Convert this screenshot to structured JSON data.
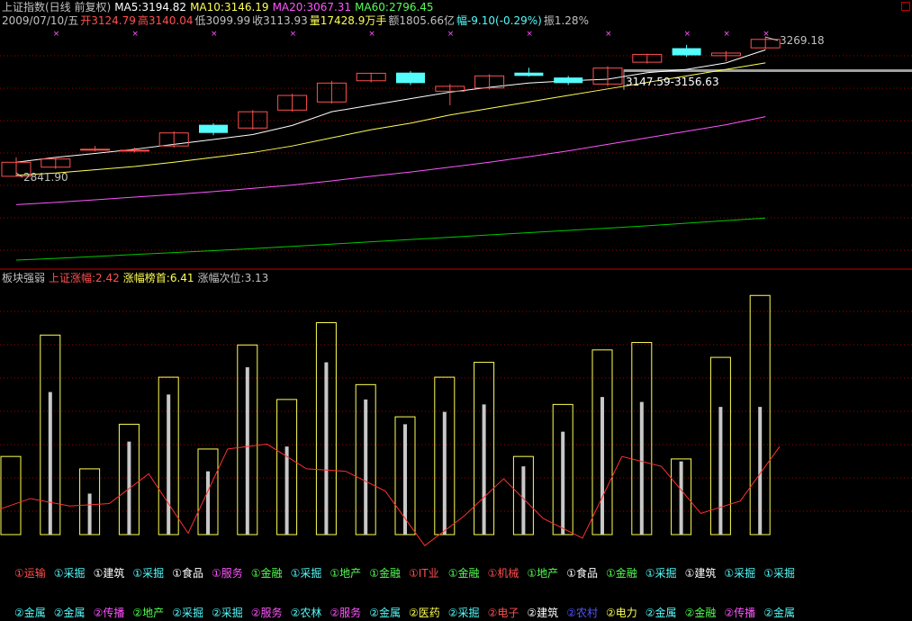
{
  "header": {
    "title": "上证指数(日线 前复权)",
    "ma5": "MA5:3194.82",
    "ma10": "MA10:3146.19",
    "ma20": "MA20:3067.31",
    "ma60": "MA60:2796.45",
    "date": "2009/07/10/五",
    "open": "开3124.79",
    "high": "高3140.04",
    "low": "低3099.99",
    "close": "收3113.93",
    "volume": "量17428.9万手",
    "amount": "额1805.66亿",
    "change": "幅-9.10(-0.29%)",
    "amplitude": "振1.28%"
  },
  "annotations": {
    "high_label": "3269.18",
    "low_label": "2841.90",
    "range_label": "3147.59-3156.63"
  },
  "panel2": {
    "title": "板块强弱",
    "sh_gain": "上证涨幅:2.42",
    "top_gain": "涨幅榜首:6.41",
    "second_gain": "涨幅次位:3.13"
  },
  "colors": {
    "up": "#ff5050",
    "down": "#54fcfc",
    "ma5": "#ffffff",
    "ma10": "#ffff55",
    "ma20": "#ff55ff",
    "ma60": "#00c800",
    "grid": "#a00000",
    "bar": "#ffff55"
  },
  "chart_data": [
    {
      "type": "candlestick",
      "candles": [
        {
          "o": 2841.9,
          "c": 2885,
          "h": 2900,
          "l": 2841.9
        },
        {
          "o": 2870,
          "c": 2895,
          "h": 2900,
          "l": 2865
        },
        {
          "o": 2925,
          "c": 2925,
          "h": 2935,
          "l": 2918
        },
        {
          "o": 2922,
          "c": 2922,
          "h": 2930,
          "l": 2915
        },
        {
          "o": 2935,
          "c": 2975,
          "h": 2980,
          "l": 2930
        },
        {
          "o": 3000,
          "c": 2975,
          "h": 3005,
          "l": 2968
        },
        {
          "o": 2990,
          "c": 3040,
          "h": 3045,
          "l": 2985
        },
        {
          "o": 3045,
          "c": 3090,
          "h": 3095,
          "l": 3040
        },
        {
          "o": 3070,
          "c": 3128,
          "h": 3135,
          "l": 3065
        },
        {
          "o": 3135,
          "c": 3158,
          "h": 3160,
          "l": 3130
        },
        {
          "o": 3160,
          "c": 3128,
          "h": 3165,
          "l": 3122
        },
        {
          "o": 3103,
          "c": 3118,
          "h": 3125,
          "l": 3060
        },
        {
          "o": 3113,
          "c": 3150,
          "h": 3155,
          "l": 3108
        },
        {
          "o": 3160,
          "c": 3150,
          "h": 3175,
          "l": 3148
        },
        {
          "o": 3145,
          "c": 3128,
          "h": 3150,
          "l": 3122
        },
        {
          "o": 3125,
          "c": 3174,
          "h": 3180,
          "l": 3118
        },
        {
          "o": 3192,
          "c": 3216,
          "h": 3218,
          "l": 3188
        },
        {
          "o": 3235,
          "c": 3213,
          "h": 3245,
          "l": 3208
        },
        {
          "o": 3212,
          "c": 3220,
          "h": 3226,
          "l": 3195
        },
        {
          "o": 3236,
          "c": 3262,
          "h": 3269.18,
          "l": 3232
        }
      ],
      "ma": {
        "MA5": [
          2885,
          2900,
          2912,
          2925,
          2940,
          2955,
          2970,
          2998,
          3040,
          3060,
          3080,
          3100,
          3115,
          3128,
          3135,
          3140,
          3160,
          3170,
          3190,
          3230
        ],
        "MA10": [
          2845,
          2852,
          2862,
          2872,
          2885,
          2900,
          2915,
          2935,
          2960,
          2985,
          3005,
          3030,
          3050,
          3070,
          3090,
          3110,
          3130,
          3150,
          3170,
          3190
        ],
        "MA20": [
          2755,
          2762,
          2770,
          2778,
          2786,
          2795,
          2805,
          2815,
          2828,
          2842,
          2855,
          2870,
          2885,
          2902,
          2920,
          2940,
          2960,
          2980,
          3000,
          3025
        ],
        "MA60": [
          2585,
          2590,
          2596,
          2602,
          2608,
          2614,
          2620,
          2627,
          2634,
          2641,
          2648,
          2655,
          2662,
          2669,
          2676,
          2683,
          2690,
          2698,
          2706,
          2714
        ]
      },
      "ylim": [
        2560,
        3300
      ]
    },
    {
      "type": "bar",
      "bars": [
        {
          "outer": 1.05,
          "inner": 0
        },
        {
          "outer": 3.5,
          "inner": 2.35
        },
        {
          "outer": 0.8,
          "inner": 0.3
        },
        {
          "outer": 1.7,
          "inner": 1.35
        },
        {
          "outer": 2.65,
          "inner": 2.3
        },
        {
          "outer": 1.2,
          "inner": 0.75
        },
        {
          "outer": 3.3,
          "inner": 2.85
        },
        {
          "outer": 2.2,
          "inner": 1.25
        },
        {
          "outer": 3.75,
          "inner": 2.95
        },
        {
          "outer": 2.5,
          "inner": 2.2
        },
        {
          "outer": 1.85,
          "inner": 1.7
        },
        {
          "outer": 2.65,
          "inner": 1.95
        },
        {
          "outer": 2.95,
          "inner": 2.1
        },
        {
          "outer": 1.05,
          "inner": 0.85
        },
        {
          "outer": 2.1,
          "inner": 1.55
        },
        {
          "outer": 3.2,
          "inner": 2.25
        },
        {
          "outer": 3.35,
          "inner": 2.15
        },
        {
          "outer": 1.0,
          "inner": 0.95
        },
        {
          "outer": 3.05,
          "inner": 2.05
        },
        {
          "outer": 4.3,
          "inner": 2.05
        }
      ],
      "line": [
        -0.05,
        0.2,
        0.05,
        0.1,
        0.7,
        -0.5,
        1.2,
        1.3,
        0.8,
        0.75,
        0.35,
        -0.75,
        -0.15,
        0.6,
        -0.2,
        -0.6,
        1.05,
        0.85,
        -0.1,
        0.15,
        1.25
      ],
      "ylim": [
        -0.6,
        4.45
      ]
    }
  ],
  "labels_row1": [
    {
      "text": "①运输",
      "color": "#ff5050"
    },
    {
      "text": "①采掘",
      "color": "#54fcfc"
    },
    {
      "text": "①建筑",
      "color": "#ffffff"
    },
    {
      "text": "①采掘",
      "color": "#54fcfc"
    },
    {
      "text": "①食品",
      "color": "#ffffff"
    },
    {
      "text": "①服务",
      "color": "#ff55ff"
    },
    {
      "text": "①金融",
      "color": "#55ff55"
    },
    {
      "text": "①采掘",
      "color": "#54fcfc"
    },
    {
      "text": "①地产",
      "color": "#55ff55"
    },
    {
      "text": "①金融",
      "color": "#55ff55"
    },
    {
      "text": "①IT业",
      "color": "#ff5050"
    },
    {
      "text": "①金融",
      "color": "#55ff55"
    },
    {
      "text": "①机械",
      "color": "#ff5050"
    },
    {
      "text": "①地产",
      "color": "#55ff55"
    },
    {
      "text": "①食品",
      "color": "#ffffff"
    },
    {
      "text": "①金融",
      "color": "#55ff55"
    },
    {
      "text": "①采掘",
      "color": "#54fcfc"
    },
    {
      "text": "①建筑",
      "color": "#ffffff"
    },
    {
      "text": "①采掘",
      "color": "#54fcfc"
    },
    {
      "text": "①采掘",
      "color": "#54fcfc"
    }
  ],
  "labels_row2": [
    {
      "text": "②金属",
      "color": "#54fcfc"
    },
    {
      "text": "②金属",
      "color": "#54fcfc"
    },
    {
      "text": "②传播",
      "color": "#ff55ff"
    },
    {
      "text": "②地产",
      "color": "#55ff55"
    },
    {
      "text": "②采掘",
      "color": "#54fcfc"
    },
    {
      "text": "②采掘",
      "color": "#54fcfc"
    },
    {
      "text": "②服务",
      "color": "#ff55ff"
    },
    {
      "text": "②农林",
      "color": "#54fcfc"
    },
    {
      "text": "②服务",
      "color": "#ff55ff"
    },
    {
      "text": "②金属",
      "color": "#54fcfc"
    },
    {
      "text": "②医药",
      "color": "#ffff55"
    },
    {
      "text": "②采掘",
      "color": "#54fcfc"
    },
    {
      "text": "②电子",
      "color": "#ff5050"
    },
    {
      "text": "②建筑",
      "color": "#ffffff"
    },
    {
      "text": "②农村",
      "color": "#5555ff"
    },
    {
      "text": "②电力",
      "color": "#ffff55"
    },
    {
      "text": "②金属",
      "color": "#54fcfc"
    },
    {
      "text": "②金融",
      "color": "#55ff55"
    },
    {
      "text": "②传播",
      "color": "#ff55ff"
    },
    {
      "text": "②金属",
      "color": "#54fcfc"
    }
  ]
}
